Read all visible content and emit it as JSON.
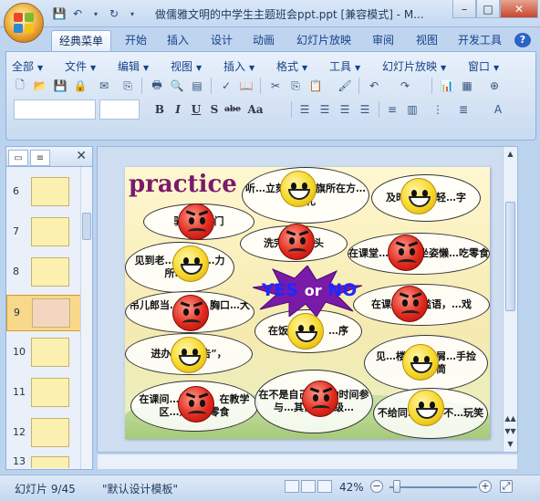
{
  "window": {
    "title": "做儒雅文明的中学生主题班会ppt.ppt [兼容模式] - M...",
    "controls": [
      "–",
      "□",
      "✕"
    ]
  },
  "ribbon_tabs": [
    "经典菜单",
    "开始",
    "插入",
    "设计",
    "动画",
    "幻灯片放映",
    "审阅",
    "视图",
    "开发工具"
  ],
  "active_tab": "经典菜单",
  "classic_menus": [
    "全部",
    "文件",
    "编辑",
    "视图",
    "插入",
    "格式",
    "工具",
    "幻灯片放映",
    "窗口"
  ],
  "format_buttons": [
    "B",
    "I",
    "U",
    "S",
    "abe",
    "Aa"
  ],
  "slide_panel": {
    "slide_numbers": [
      "6",
      "7",
      "8",
      "9",
      "10",
      "11",
      "12",
      "13"
    ],
    "selected": "9"
  },
  "slide": {
    "heading": "practice",
    "yes": "YES",
    "or": "or",
    "no": "NO",
    "bubbles": [
      "听…立刻止步…旗所在方…目礼",
      "及时…书、轻…字",
      "骑单…校门",
      "洗完手…龙头",
      "见到老…好，帮…力所…情",
      "在课堂…说话、坐姿懒…吃零食",
      "吊儿郎当…校服，胸口…大敞",
      "在课室…言滥语，…戏",
      "在饭…打饭，…序",
      "进办公…报告”，",
      "见…楼梯有纸屑…手捡起，…筒",
      "在课间…买零食，在教学区…道上吃零食",
      "在不是自己…活动时间参与…其他…年级…",
      "不给同…绰号”不…玩笑"
    ]
  },
  "status": {
    "slide_info": "幻灯片 9/45",
    "theme": "\"默认设计模板\"",
    "zoom": "42%"
  }
}
